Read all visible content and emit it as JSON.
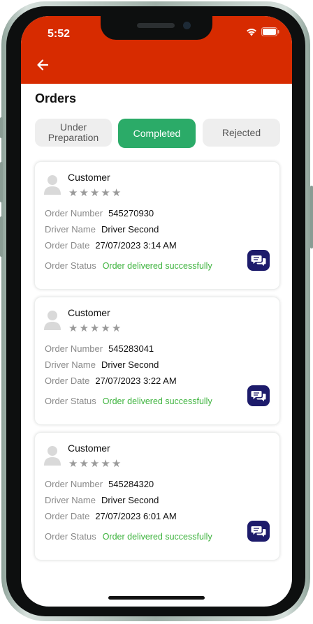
{
  "status_bar": {
    "time": "5:52"
  },
  "page": {
    "title": "Orders"
  },
  "tabs": [
    {
      "label": "Under\nPreparation",
      "active": false
    },
    {
      "label": "Completed",
      "active": true
    },
    {
      "label": "Rejected",
      "active": false
    }
  ],
  "labels": {
    "order_number": "Order Number",
    "driver_name": "Driver Name",
    "order_date": "Order Date",
    "order_status": "Order Status"
  },
  "orders": [
    {
      "customer": "Customer",
      "rating": 0,
      "order_number": "545270930",
      "driver_name": "Driver Second",
      "order_date": "27/07/2023 3:14 AM",
      "status": "Order delivered successfully"
    },
    {
      "customer": "Customer",
      "rating": 0,
      "order_number": "545283041",
      "driver_name": "Driver Second",
      "order_date": "27/07/2023 3:22 AM",
      "status": "Order delivered successfully"
    },
    {
      "customer": "Customer",
      "rating": 0,
      "order_number": "545284320",
      "driver_name": "Driver Second",
      "order_date": "27/07/2023 6:01 AM",
      "status": "Order delivered successfully"
    }
  ],
  "colors": {
    "header": "#d72b00",
    "active_tab": "#2bab68",
    "status_green": "#3db33d",
    "chat_button": "#1d1b6b"
  },
  "icons": {
    "back": "arrow-left-icon",
    "avatar": "person-icon",
    "chat": "chat-bubbles-icon",
    "star": "star-icon"
  }
}
